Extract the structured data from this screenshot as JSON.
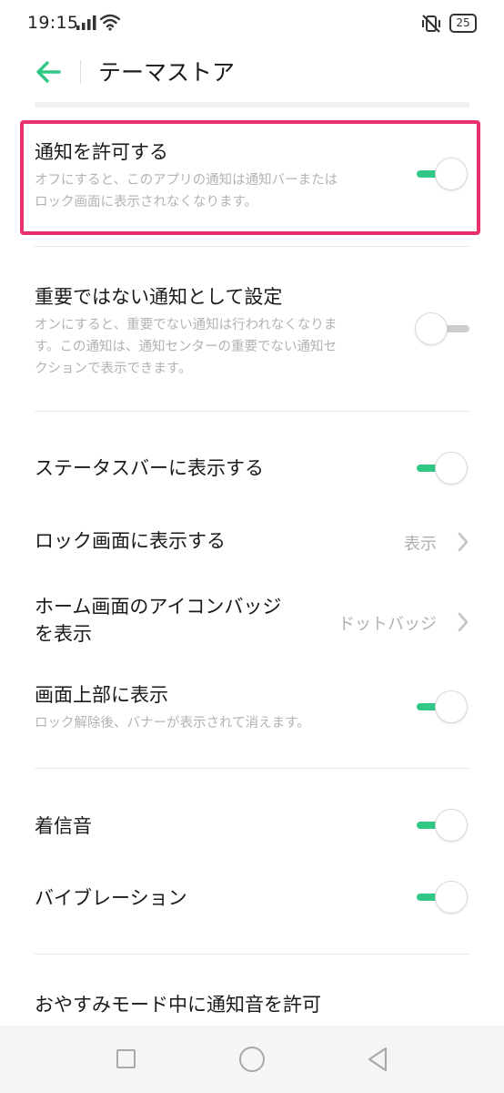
{
  "status_bar": {
    "time": "19:15",
    "battery": "25",
    "icons": [
      "signal-icon",
      "wifi-icon",
      "vibrate-mute-icon",
      "battery-icon"
    ]
  },
  "app_bar": {
    "title": "テーマストア",
    "back_icon": "back-arrow-icon"
  },
  "settings": {
    "allow_notifications": {
      "title": "通知を許可する",
      "description_line1": "オフにすると、このアプリの通知は通知バーまたは",
      "description_line2": "ロック画面に表示されなくなります。",
      "enabled": true
    },
    "set_unimportant": {
      "title": "重要ではない通知として設定",
      "description_line1": "オンにすると、重要でない通知は行われなくなりま",
      "description_line2": "す。この通知は、通知センターの重要でない通知セ",
      "description_line3": "クションで表示できます。",
      "enabled": false
    },
    "show_in_status_bar": {
      "title": "ステータスバーに表示する",
      "enabled": true
    },
    "show_on_lock_screen": {
      "title": "ロック画面に表示する",
      "value": "表示"
    },
    "home_badge": {
      "title_line1": "ホーム画面のアイコンバッジ",
      "title_line2": "を表示",
      "value": "ドットバッジ"
    },
    "show_at_top": {
      "title": "画面上部に表示",
      "description": "ロック解除後、バナーが表示されて消えます。",
      "enabled": true
    },
    "ringtone": {
      "title": "着信音",
      "enabled": true
    },
    "vibration": {
      "title": "バイブレーション",
      "enabled": true
    },
    "dnd_sound": {
      "title": "おやすみモード中に通知音を許可"
    }
  },
  "colors": {
    "accent": "#30c884",
    "highlight": "#e8306a",
    "secondary_text": "#b3b3b3"
  }
}
